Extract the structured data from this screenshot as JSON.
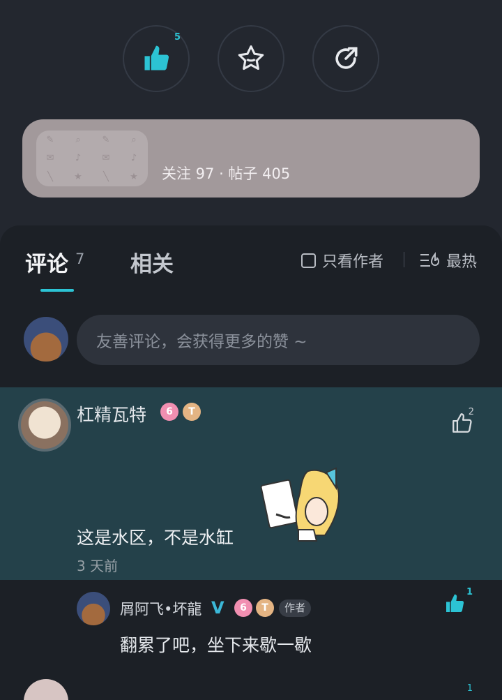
{
  "actions": {
    "like_count": "5",
    "like_icon": "thumbs-up-icon",
    "favorite_icon": "star-icon",
    "share_icon": "share-icon",
    "accent": "#2cc3d4"
  },
  "user_card": {
    "stats": "关注 97 · 帖子 405",
    "background": "#a2999b"
  },
  "tabs": {
    "comments_label": "评论",
    "comments_count": "7",
    "related_label": "相关",
    "author_only_label": "只看作者",
    "sort_label": "最热"
  },
  "comment_input": {
    "placeholder": "友善评论，会获得更多的赞 ~"
  },
  "comment": {
    "author": "杠精瓦特",
    "level_badge_1": "6",
    "level_badge_2": "T",
    "like_count": "2",
    "text": "这是水区，不是水缸",
    "time": "3 天前"
  },
  "reply": {
    "author": "屑阿飞•坏龍",
    "verified_mark": "V",
    "level_badge_1": "6",
    "level_badge_2": "T",
    "author_tag": "作者",
    "text": "翻累了吧，坐下来歇一歇",
    "like_count": "1"
  },
  "next_comment": {
    "like_count": "1"
  }
}
